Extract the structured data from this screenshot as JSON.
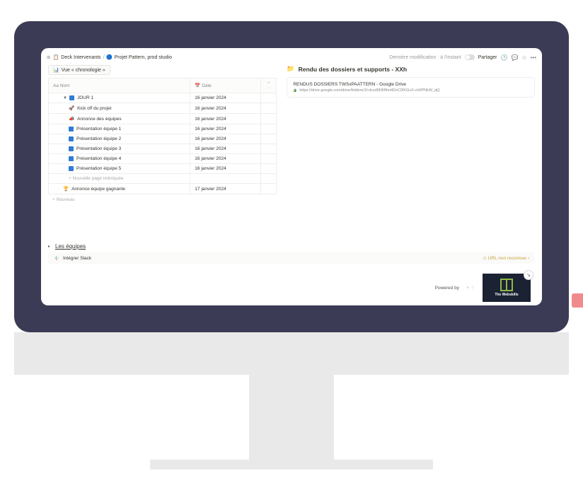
{
  "breadcrumb": {
    "item1_icon": "📋",
    "item1": "Deck Intervenants",
    "sep": "/",
    "item2_icon": "🔵",
    "item2": "Projet Pattern, prod studio"
  },
  "topright": {
    "last_modified": "Dernière modification : à l'instant",
    "share": "Partager"
  },
  "view_tab": {
    "icon": "📊",
    "label": "Vue « chronologie »"
  },
  "table": {
    "col_name": "Aa Nom",
    "col_date": "Date",
    "col_date_icon": "📅",
    "actions": "+  ···",
    "rows": [
      {
        "indent": 1,
        "tri": "▼",
        "icon": "sq",
        "name": "JOUR 1",
        "date": "16 janvier 2024"
      },
      {
        "indent": 2,
        "emoji": "🚀",
        "name": "Kick off du projet",
        "date": "16 janvier 2024"
      },
      {
        "indent": 2,
        "emoji": "📣",
        "name": "Annonce des équipes",
        "date": "16 janvier 2024"
      },
      {
        "indent": 2,
        "icon": "sq",
        "name": "Présentation équipe 1",
        "date": "16 janvier 2024"
      },
      {
        "indent": 2,
        "icon": "sq",
        "name": "Présentation équipe 2",
        "date": "16 janvier 2024"
      },
      {
        "indent": 2,
        "icon": "sq",
        "name": "Présentation équipe 3",
        "date": "16 janvier 2024"
      },
      {
        "indent": 2,
        "icon": "sq",
        "name": "Présentation équipe 4",
        "date": "16 janvier 2024"
      },
      {
        "indent": 2,
        "icon": "sq",
        "name": "Présentation équipe 5",
        "date": "16 janvier 2024"
      },
      {
        "indent": 2,
        "newrow": true,
        "name": "+  Nouvelle page imbriquée"
      },
      {
        "indent": 1,
        "emoji": "🏆",
        "name": "Annonce équipe gagnante",
        "date": "17 janvier 2024"
      }
    ],
    "add_row": "+  Nouveau"
  },
  "right_panel": {
    "title": "Rendu des dossiers et supports - XXh",
    "link_title": "RENDUS DOSSIERS TWSxPAATTERN - Google Drive",
    "link_url": "https://drive.google.com/drive/folders/1f-dczd0N5f9m4DsC0fXGvX-ch9PNkW_qQ"
  },
  "teams": {
    "heading": "Les équipes",
    "slack_label": "Intégrer Slack",
    "warn": "⚠ URL non reconnue ›"
  },
  "footer": {
    "powered": "Powered by",
    "logo_text": "The Webskills",
    "plus": "+  ⋮"
  }
}
